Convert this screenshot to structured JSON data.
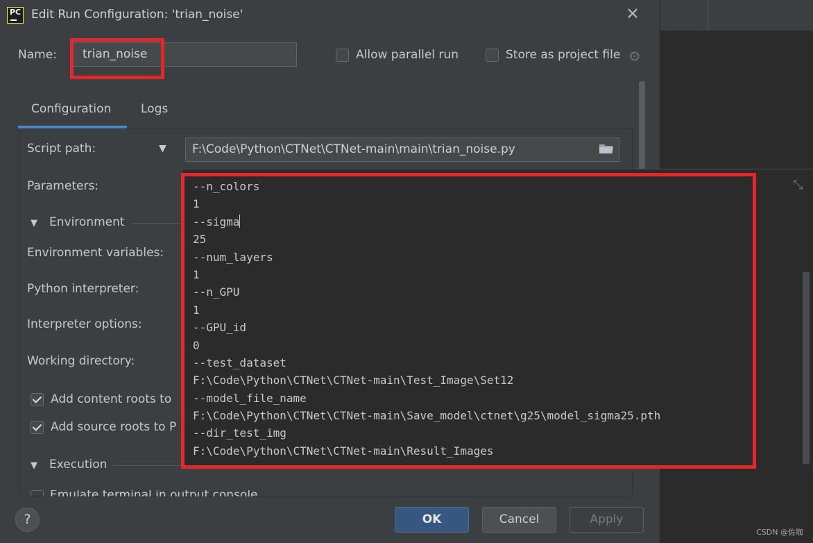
{
  "dialog": {
    "title": "Edit Run Configuration: 'trian_noise'",
    "app_icon_text": "PC",
    "close_glyph": "✕"
  },
  "name_row": {
    "label": "Name:",
    "value": "trian_noise",
    "allow_parallel_label": "Allow parallel run",
    "allow_parallel_checked": false,
    "store_project_label": "Store as project file",
    "store_project_checked": false
  },
  "tabs": [
    {
      "label": "Configuration",
      "active": true
    },
    {
      "label": "Logs",
      "active": false
    }
  ],
  "form": {
    "script_path_label": "Script path:",
    "script_path_value": "F:\\Code\\Python\\CTNet\\CTNet-main\\main\\trian_noise.py",
    "parameters_label": "Parameters:",
    "environment_section": "Environment",
    "env_vars_label": "Environment variables:",
    "python_interpreter_label": "Python interpreter:",
    "interpreter_options_label": "Interpreter options:",
    "working_directory_label": "Working directory:",
    "add_content_roots_label": "Add content roots to",
    "add_content_roots_checked": true,
    "add_source_roots_label": "Add source roots to P",
    "add_source_roots_checked": true,
    "execution_section": "Execution",
    "partial_option_label": "Emulate terminal in output console"
  },
  "parameters_popup": {
    "lines": [
      "--n_colors",
      "1",
      "--sigma",
      "25",
      "--num_layers",
      "1",
      "--n_GPU",
      "1",
      "--GPU_id",
      "0",
      "--test_dataset",
      "F:\\Code\\Python\\CTNet\\CTNet-main\\Test_Image\\Set12",
      "--model_file_name",
      "F:\\Code\\Python\\CTNet\\CTNet-main\\Save_model\\ctnet\\g25\\model_sigma25.pth",
      "--dir_test_img",
      "F:\\Code\\Python\\CTNet\\CTNet-main\\Result_Images"
    ],
    "caret_line": 2
  },
  "buttons": {
    "help": "?",
    "ok": "OK",
    "cancel": "Cancel",
    "apply": "Apply"
  },
  "watermark": "CSDN @佐咖",
  "colors": {
    "dialog_bg": "#3c3f41",
    "editor_bg": "#2b2b2b",
    "highlight_red": "#e5262b",
    "tab_accent": "#4a88c7",
    "ok_button": "#365880"
  }
}
